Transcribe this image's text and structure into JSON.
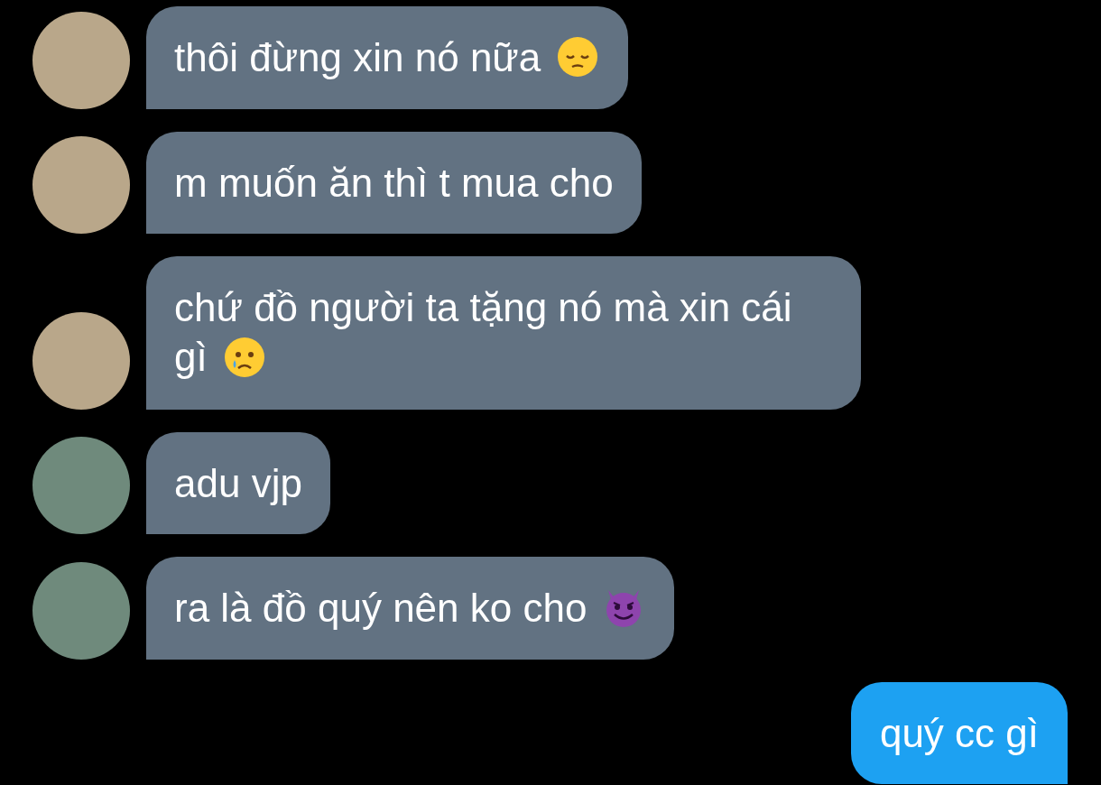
{
  "messages": [
    {
      "kind": "incoming",
      "avatar": {
        "kind": "plush"
      },
      "parts": [
        {
          "kind": "text",
          "text": "thôi đừng xin nó nữa"
        },
        {
          "kind": "pensive"
        }
      ]
    },
    {
      "kind": "incoming",
      "avatar": {
        "kind": "plush"
      },
      "parts": [
        {
          "kind": "text",
          "text": "m muốn ăn thì t mua cho"
        }
      ]
    },
    {
      "kind": "incoming",
      "avatar": {
        "kind": "plush"
      },
      "parts": [
        {
          "kind": "text",
          "text": "chứ đồ người ta tặng nó mà xin cái gì"
        },
        {
          "kind": "crying"
        }
      ]
    },
    {
      "kind": "incoming",
      "avatar": {
        "kind": "boy"
      },
      "parts": [
        {
          "kind": "text",
          "text": "adu vjp"
        }
      ]
    },
    {
      "kind": "incoming",
      "avatar": {
        "kind": "boy"
      },
      "parts": [
        {
          "kind": "text",
          "text": "ra là đồ quý nên ko cho"
        },
        {
          "kind": "devil"
        }
      ]
    },
    {
      "kind": "outgoing",
      "parts": [
        {
          "kind": "text",
          "text": "quý cc gì"
        }
      ]
    }
  ]
}
